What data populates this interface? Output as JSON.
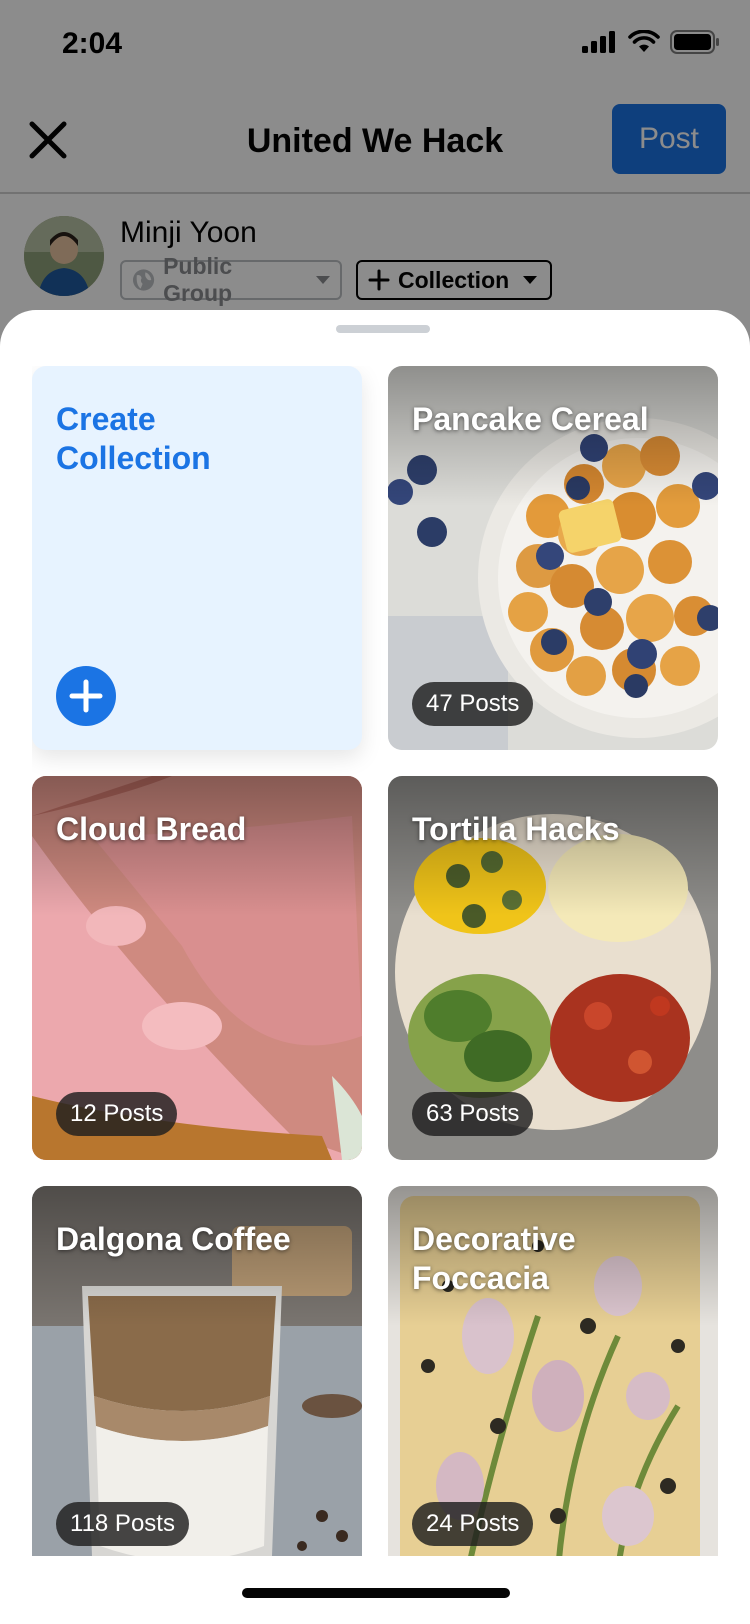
{
  "status_bar": {
    "time": "2:04"
  },
  "header": {
    "title": "United We Hack",
    "post_label": "Post"
  },
  "author": {
    "name": "Minji Yoon",
    "privacy_label": "Public Group",
    "collection_label": "Collection"
  },
  "sheet": {
    "create": {
      "title_line1": "Create",
      "title_line2": "Collection"
    },
    "collections": [
      {
        "title": "Pancake Cereal",
        "count": "47 Posts"
      },
      {
        "title": "Cloud Bread",
        "count": "12 Posts"
      },
      {
        "title": "Tortilla Hacks",
        "count": "63 Posts"
      },
      {
        "title": "Dalgona Coffee",
        "count": "118 Posts"
      },
      {
        "title_line1": "Decorative",
        "title_line2": "Foccacia",
        "count": "24 Posts"
      }
    ]
  },
  "colors": {
    "accent": "#1b74e4",
    "create_bg": "#e7f3ff",
    "badge_bg": "#1e1e1e"
  },
  "icons": [
    "close-icon",
    "globe-icon",
    "plus-icon",
    "chevron-down-icon",
    "signal-icon",
    "wifi-icon",
    "battery-icon"
  ]
}
